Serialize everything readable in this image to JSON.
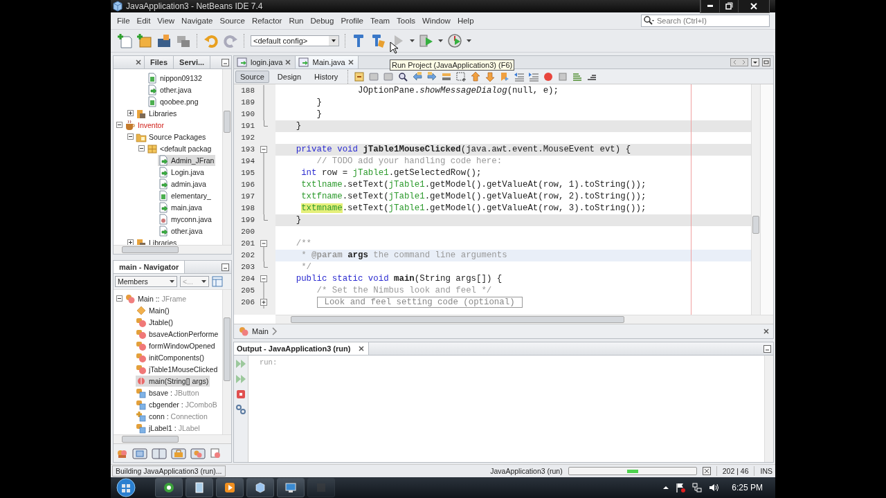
{
  "window": {
    "title": "JavaApplication3 - NetBeans IDE 7.4"
  },
  "menu": [
    "File",
    "Edit",
    "View",
    "Navigate",
    "Source",
    "Refactor",
    "Run",
    "Debug",
    "Profile",
    "Team",
    "Tools",
    "Window",
    "Help"
  ],
  "search": {
    "placeholder": "Search (Ctrl+I)"
  },
  "toolbar": {
    "config": "<default config>"
  },
  "tooltip": "Run Project (JavaApplication3) (F6)",
  "projects_panel": {
    "tabs": [
      {
        "label": "Files",
        "selected": false
      },
      {
        "label": "Servi...",
        "selected": false
      }
    ],
    "tree": [
      {
        "children": [
          {
            "children": [
              {
                "label": "nippon09132",
                "kind": "image",
                "selected": false
              },
              {
                "label": "other.java",
                "kind": "java",
                "selected": false
              },
              {
                "label": "qoobee.png",
                "kind": "image",
                "selected": false
              }
            ]
          },
          {
            "label": "Libraries",
            "kind": "library",
            "expanded": false,
            "selected": false
          }
        ]
      },
      {
        "label": "Inventor",
        "kind": "project",
        "has_errors": true,
        "expanded": true,
        "selected": false,
        "children": [
          {
            "label": "Source Packages",
            "kind": "packages",
            "expanded": true,
            "selected": false,
            "children": [
              {
                "label": "<default packag",
                "kind": "package",
                "expanded": true,
                "selected": false,
                "children": [
                  {
                    "label": "Admin_JFran",
                    "kind": "java",
                    "selected": true
                  },
                  {
                    "label": "Login.java",
                    "kind": "java",
                    "selected": false
                  },
                  {
                    "label": "admin.java",
                    "kind": "java",
                    "selected": false
                  },
                  {
                    "label": "elementary_",
                    "kind": "image",
                    "selected": false
                  },
                  {
                    "label": "main.java",
                    "kind": "java",
                    "selected": false
                  },
                  {
                    "label": "myconn.java",
                    "kind": "db",
                    "selected": false
                  },
                  {
                    "label": "other.java",
                    "kind": "java",
                    "selected": false
                  }
                ]
              }
            ]
          },
          {
            "label": "Libraries",
            "kind": "library",
            "expanded": false,
            "selected": false
          }
        ]
      }
    ]
  },
  "navigator": {
    "title": "main - Navigator",
    "filter": "Members",
    "scope": "<...",
    "tree": [
      {
        "label": "Main ::",
        "type": "JFrame",
        "kind": "class",
        "expanded": true,
        "selected": false,
        "children": [
          {
            "label": "Main()",
            "kind": "constructor",
            "selected": false
          },
          {
            "label": "Jtable()",
            "kind": "method",
            "selected": false
          },
          {
            "label": "bsaveActionPerforme",
            "kind": "method",
            "selected": false
          },
          {
            "label": "formWindowOpened",
            "kind": "method",
            "selected": false
          },
          {
            "label": "initComponents()",
            "kind": "method",
            "selected": false
          },
          {
            "label": "jTable1MouseClicked",
            "kind": "method",
            "selected": false
          },
          {
            "label": "main(String[] args)",
            "kind": "static-method",
            "selected": true
          },
          {
            "label": "bsave :",
            "type": "JButton",
            "kind": "field",
            "selected": false
          },
          {
            "label": "cbgender :",
            "type": "JComboB",
            "kind": "field",
            "selected": false
          },
          {
            "label": "conn :",
            "type": "Connection",
            "kind": "field-package",
            "selected": false
          },
          {
            "label": "jLabel1 :",
            "type": "JLabel",
            "kind": "field",
            "selected": false
          }
        ]
      }
    ]
  },
  "editor": {
    "tabs": [
      {
        "label": "login.java",
        "selected": false
      },
      {
        "label": "Main.java",
        "selected": true
      }
    ],
    "views": [
      {
        "label": "Source",
        "selected": true
      },
      {
        "label": "Design",
        "selected": false
      },
      {
        "label": "History",
        "selected": false
      }
    ],
    "lines": [
      {
        "children": [
          {
            "number": "188",
            "highlighted": false,
            "current": false,
            "tokens": [
              {
                "kind": "plain",
                "text": "                JOptionPane."
              },
              {
                "kind": "italic",
                "text": "showMessageDialog"
              },
              {
                "kind": "plain",
                "text": "(null, e);"
              }
            ]
          },
          {
            "number": "189",
            "highlighted": false,
            "current": false,
            "tokens": [
              {
                "kind": "plain",
                "text": "        }"
              }
            ]
          },
          {
            "number": "190",
            "highlighted": false,
            "current": false,
            "tokens": [
              {
                "kind": "plain",
                "text": "        }"
              }
            ]
          },
          {
            "number": "191",
            "highlighted": true,
            "current": false,
            "tokens": [
              {
                "kind": "plain",
                "text": "    }"
              }
            ]
          }
        ]
      },
      {
        "number": "192",
        "highlighted": false,
        "current": false
      },
      {
        "number": "193",
        "highlighted": true,
        "current": false,
        "expanded": true,
        "tokens": [
          {
            "kind": "keyword",
            "text": "    private void "
          },
          {
            "kind": "method",
            "text": "jTable1MouseClicked"
          },
          {
            "kind": "plain",
            "text": "(java.awt.event.MouseEvent evt) {"
          }
        ],
        "children": [
          {
            "number": "194",
            "highlighted": false,
            "current": false,
            "tokens": [
              {
                "kind": "comment",
                "text": "        // TODO add your handling code here:"
              }
            ]
          },
          {
            "number": "195",
            "highlighted": false,
            "current": false,
            "tokens": [
              {
                "kind": "keyword",
                "text": "     int"
              },
              {
                "kind": "plain",
                "text": " row = "
              },
              {
                "kind": "field",
                "text": "jTable1"
              },
              {
                "kind": "plain",
                "text": ".getSelectedRow();"
              }
            ]
          },
          {
            "number": "196",
            "highlighted": false,
            "current": false,
            "tokens": [
              {
                "kind": "field",
                "text": "     txtlname"
              },
              {
                "kind": "plain",
                "text": ".setText("
              },
              {
                "kind": "field",
                "text": "jTable1"
              },
              {
                "kind": "plain",
                "text": ".getModel().getValueAt(row, 1).toString());"
              }
            ]
          },
          {
            "number": "197",
            "highlighted": false,
            "current": false,
            "tokens": [
              {
                "kind": "field",
                "text": "     txtfname"
              },
              {
                "kind": "plain",
                "text": ".setText("
              },
              {
                "kind": "field",
                "text": "jTable1"
              },
              {
                "kind": "plain",
                "text": ".getModel().getValueAt(row, 2).toString());"
              }
            ]
          },
          {
            "number": "198",
            "highlighted": false,
            "current": false,
            "tokens": [
              {
                "kind": "mark",
                "text": "     txtmname"
              },
              {
                "kind": "plain",
                "text": ".setText("
              },
              {
                "kind": "field",
                "text": "jTable1"
              },
              {
                "kind": "plain",
                "text": ".getModel().getValueAt(row, 3).toString());"
              }
            ]
          },
          {
            "number": "199",
            "highlighted": true,
            "current": false,
            "tokens": [
              {
                "kind": "plain",
                "text": "    }"
              }
            ]
          }
        ]
      },
      {
        "number": "200",
        "highlighted": false,
        "current": false
      },
      {
        "number": "201",
        "highlighted": false,
        "current": false,
        "expanded": true,
        "tokens": [
          {
            "kind": "comment",
            "text": "    /**"
          }
        ],
        "children": [
          {
            "number": "202",
            "highlighted": false,
            "current": true,
            "tokens": [
              {
                "kind": "comment",
                "text": "     * "
              },
              {
                "kind": "tag",
                "text": "@param"
              },
              {
                "kind": "bold",
                "text": " args"
              },
              {
                "kind": "comment",
                "text": " the command line arguments"
              }
            ]
          },
          {
            "number": "203",
            "highlighted": false,
            "current": false,
            "tokens": [
              {
                "kind": "comment",
                "text": "     */"
              }
            ]
          }
        ]
      },
      {
        "number": "204",
        "highlighted": false,
        "current": false,
        "expanded": true,
        "tokens": [
          {
            "kind": "keyword",
            "text": "    public static void "
          },
          {
            "kind": "method",
            "text": "main"
          },
          {
            "kind": "plain",
            "text": "(String args[]) {"
          }
        ],
        "children": [
          {
            "number": "205",
            "highlighted": false,
            "current": false,
            "tokens": [
              {
                "kind": "comment",
                "text": "        /* Set the Nimbus look and feel */"
              }
            ]
          },
          {
            "number": "206",
            "highlighted": false,
            "current": false,
            "expanded": false,
            "tokens": [
              {
                "kind": "folded",
                "text": "        Look and feel setting code (optional)"
              }
            ]
          }
        ]
      }
    ],
    "breadcrumb": "Main"
  },
  "output": {
    "title": "Output - JavaApplication3 (run)",
    "lines": [
      "run:"
    ]
  },
  "status_bar": {
    "message": "Building JavaApplication3 (run)...",
    "task": "JavaApplication3 (run)",
    "position": "202 | 46",
    "mode": "INS"
  },
  "taskbar": {
    "clock": "6:25 PM"
  }
}
